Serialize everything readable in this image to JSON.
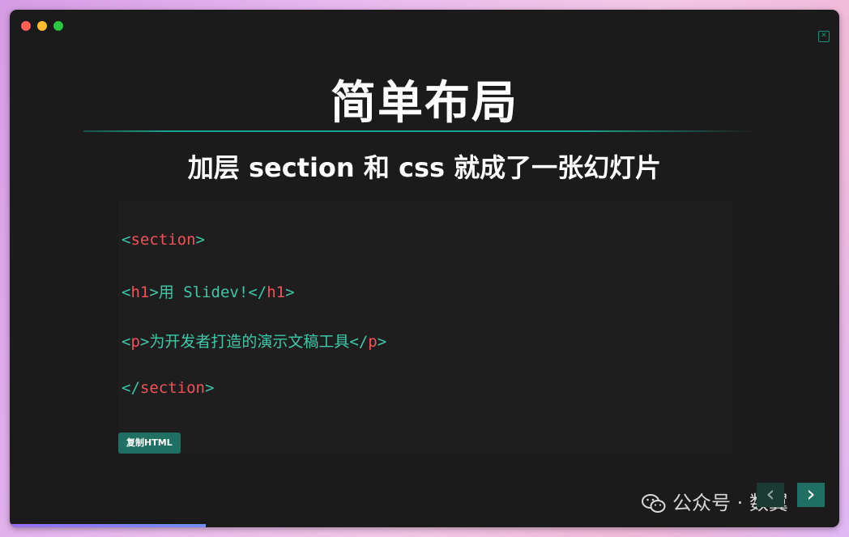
{
  "slide": {
    "title": "简单布局",
    "subtitle": "加层 section 和 css 就成了一张幻灯片"
  },
  "code": {
    "lines": [
      {
        "open": "<",
        "name": "section",
        "close": ">",
        "text": "",
        "open2": "",
        "name2": "",
        "close2": ""
      },
      {
        "open": "<",
        "name": "h1",
        "close": ">",
        "text": "用 Slidev!",
        "open2": "</",
        "name2": "h1",
        "close2": ">"
      },
      {
        "open": "<",
        "name": "p",
        "close": ">",
        "text": "为开发者打造的演示文稿工具",
        "open2": "</",
        "name2": "p",
        "close2": ">"
      },
      {
        "open": "</",
        "name": "section",
        "close": ">",
        "text": "",
        "open2": "",
        "name2": "",
        "close2": ""
      }
    ]
  },
  "toolbar": {
    "copy_label": "复制HTML"
  },
  "nav": {
    "prev_icon": "chevron-left-icon",
    "next_icon": "chevron-right-icon",
    "prev_glyph": "‹",
    "next_glyph": "›"
  },
  "watermark": {
    "text": "公众号 · 数翼"
  },
  "progress": {
    "fraction": 0.236
  },
  "colors": {
    "accent": "#1f6f63",
    "tag_name": "#f0525a",
    "tag_bracket": "#3ec8a8",
    "background": "#1b1b1b"
  }
}
